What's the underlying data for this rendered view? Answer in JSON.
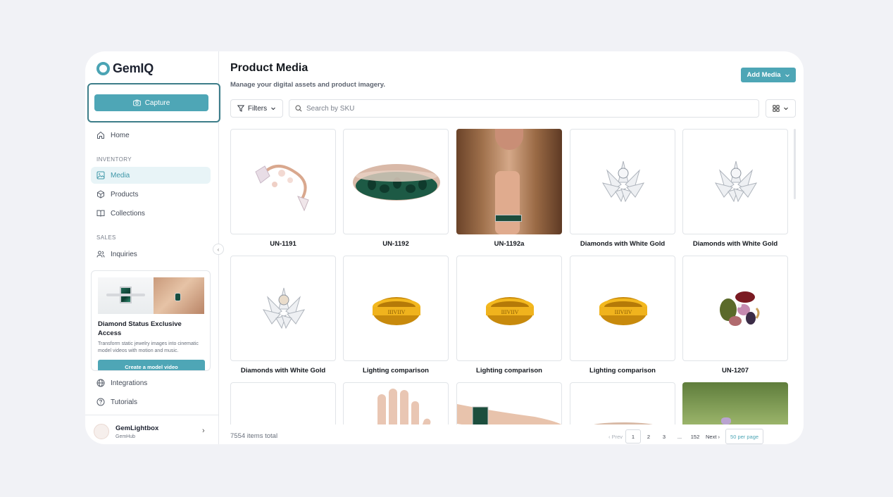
{
  "app": {
    "name": "GemIQ"
  },
  "sidebar": {
    "capture_label": "Capture",
    "home_label": "Home",
    "inventory_section": "INVENTORY",
    "media_label": "Media",
    "products_label": "Products",
    "collections_label": "Collections",
    "sales_section": "SALES",
    "inquiries_label": "Inquiries",
    "integrations_label": "Integrations",
    "tutorials_label": "Tutorials",
    "promo": {
      "title": "Diamond Status Exclusive Access",
      "description": "Transform static jewelry images into cinematic model videos with motion and music.",
      "cta": "Create a model video"
    },
    "account": {
      "name": "GemLightbox",
      "org": "GemHub"
    }
  },
  "header": {
    "title": "Product Media",
    "subtitle": "Manage your digital assets and product imagery.",
    "add_media_label": "Add Media"
  },
  "toolbar": {
    "filters_label": "Filters",
    "search_placeholder": "Search by SKU"
  },
  "media": {
    "items": [
      {
        "label": "UN-1191",
        "thumb": "rose-gold-ring"
      },
      {
        "label": "UN-1192",
        "thumb": "emerald-bracelet"
      },
      {
        "label": "UN-1192a",
        "thumb": "model-wearing-bracelet"
      },
      {
        "label": "Diamonds with White Gold",
        "thumb": "diamond-cluster"
      },
      {
        "label": "Diamonds with White Gold",
        "thumb": "diamond-cluster"
      },
      {
        "label": "Diamonds with White Gold",
        "thumb": "diamond-cluster"
      },
      {
        "label": "Lighting comparison",
        "thumb": "gold-band"
      },
      {
        "label": "Lighting comparison",
        "thumb": "gold-band"
      },
      {
        "label": "Lighting comparison",
        "thumb": "gold-band"
      },
      {
        "label": "UN-1207",
        "thumb": "multi-gem-ring"
      },
      {
        "label": "",
        "thumb": "blank"
      },
      {
        "label": "",
        "thumb": "hand"
      },
      {
        "label": "",
        "thumb": "wrist-bracelet"
      },
      {
        "label": "",
        "thumb": "bracelet-partial"
      },
      {
        "label": "",
        "thumb": "grass-photo"
      }
    ]
  },
  "footer": {
    "total": "7554 items total",
    "prev": "‹ Prev",
    "pages": [
      "1",
      "2",
      "3",
      "...",
      "152"
    ],
    "next": "Next ›",
    "per_page": "50 per page"
  },
  "colors": {
    "accent": "#4ea6b6",
    "capture_outline": "#3c7d89"
  }
}
